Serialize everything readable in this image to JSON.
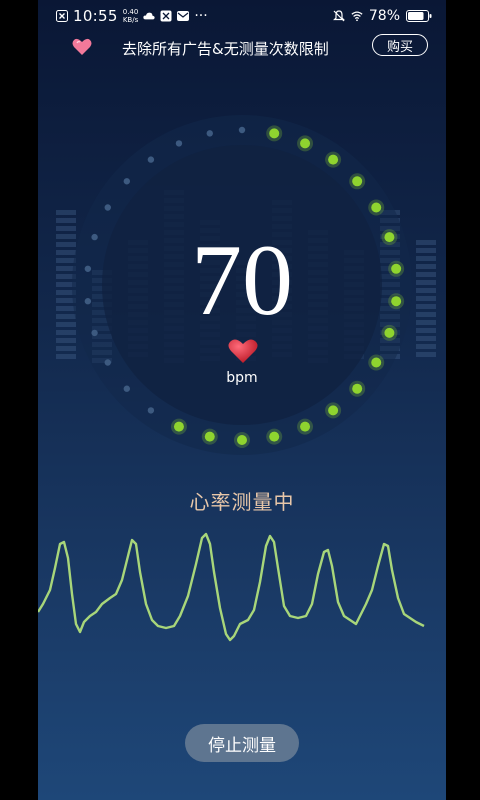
{
  "status_bar": {
    "time": "10:55",
    "net_speed_value": "0.40",
    "net_speed_unit": "KB/s",
    "more_indicator": "···",
    "battery": "78%"
  },
  "promo": {
    "text": "去除所有广告&无测量次数限制",
    "buy_label": "购买"
  },
  "measurement": {
    "bpm_value": "70",
    "unit": "bpm",
    "status": "心率测量中",
    "progress_fraction": 0.55
  },
  "actions": {
    "stop_label": "停止测量"
  },
  "colors": {
    "accent_green": "#8fd42f",
    "inactive_dot": "#3d5a80",
    "wave": "#a8d67a",
    "status_text": "#e8c7a9",
    "heart": "#d9223a"
  }
}
